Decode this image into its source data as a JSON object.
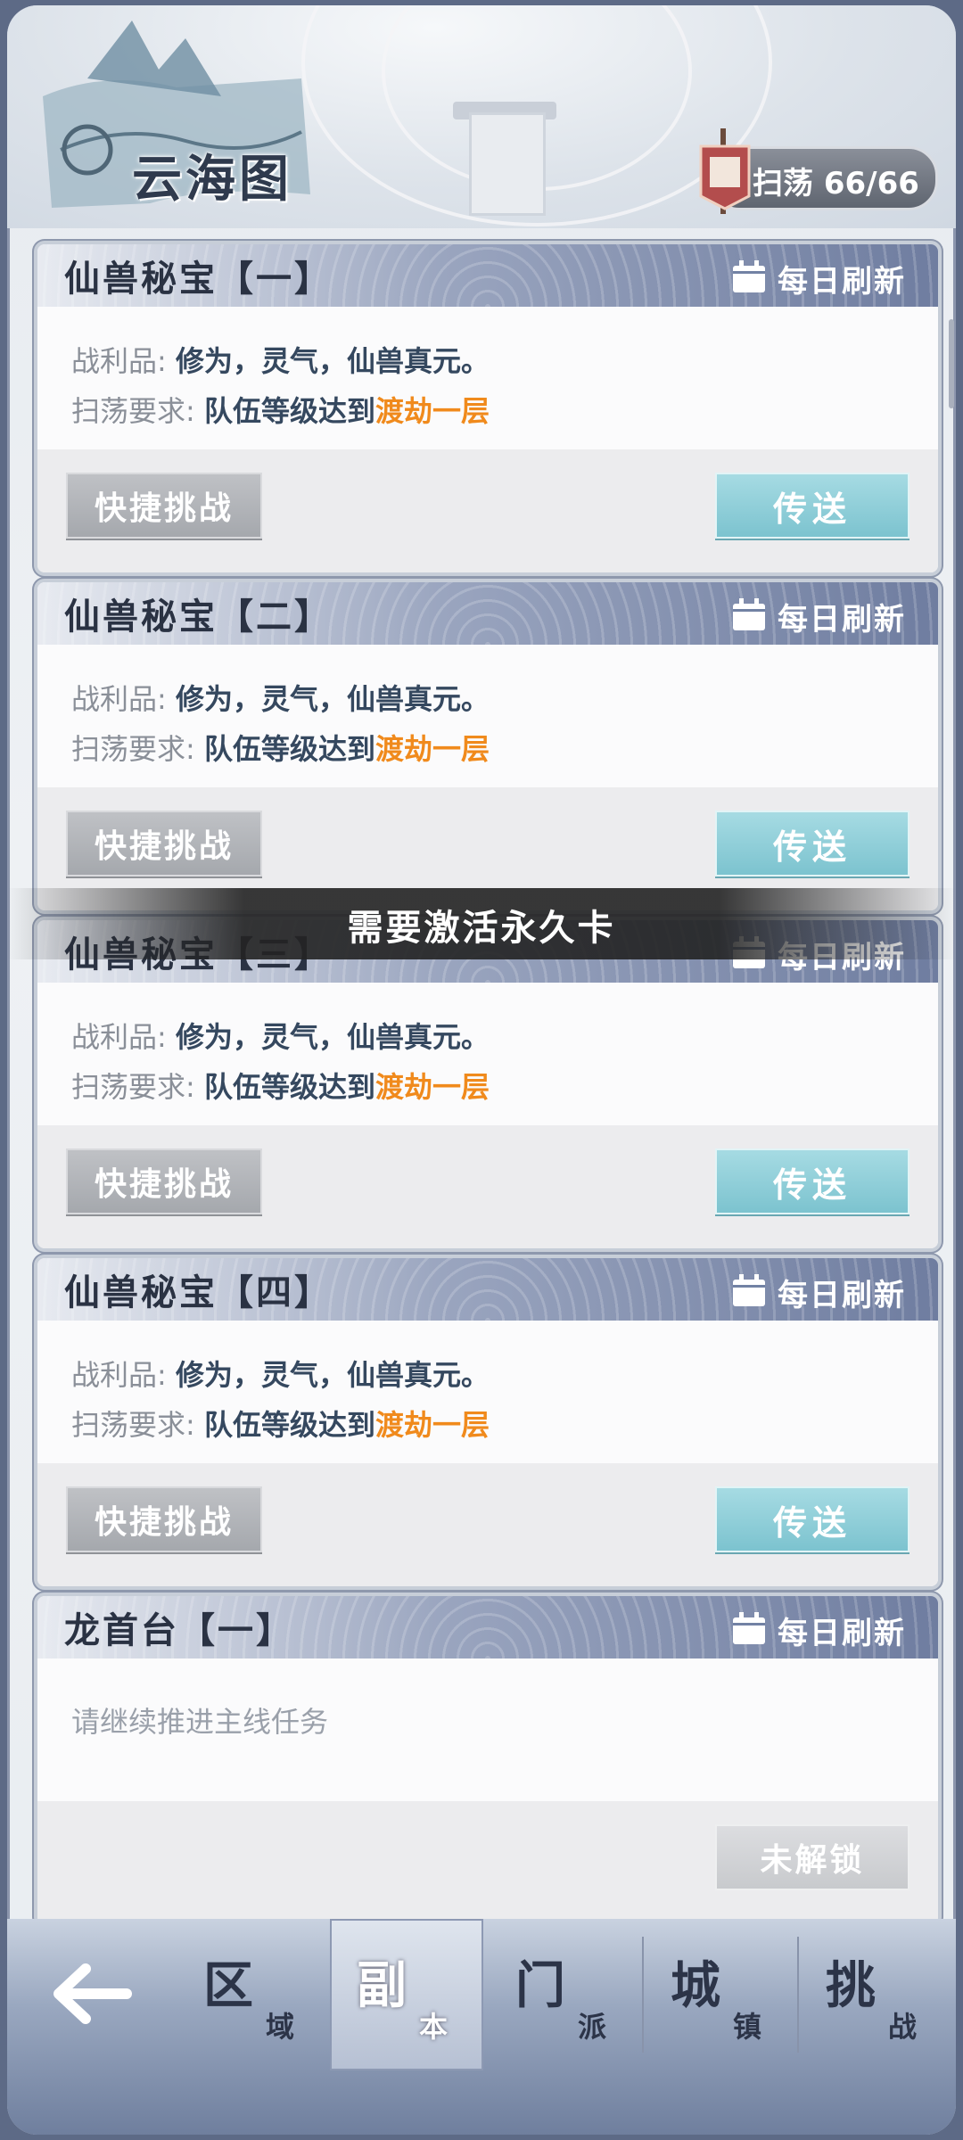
{
  "header": {
    "title": "云海图",
    "sweep_label": "扫荡 66/66",
    "flag_char": "扫荡"
  },
  "cards": [
    {
      "title": "仙兽秘宝【一】",
      "refresh": "每日刷新",
      "loot_label": "战利品:",
      "loot_value": "修为，灵气，仙兽真元。",
      "req_label": "扫荡要求:",
      "req_value": "队伍等级达到",
      "req_highlight": "渡劫一层",
      "quick_button": "快捷挑战",
      "teleport_button": "传送"
    },
    {
      "title": "仙兽秘宝【二】",
      "refresh": "每日刷新",
      "loot_label": "战利品:",
      "loot_value": "修为，灵气，仙兽真元。",
      "req_label": "扫荡要求:",
      "req_value": "队伍等级达到",
      "req_highlight": "渡劫一层",
      "quick_button": "快捷挑战",
      "teleport_button": "传送"
    },
    {
      "title": "仙兽秘宝【三】",
      "refresh": "每日刷新",
      "loot_label": "战利品:",
      "loot_value": "修为，灵气，仙兽真元。",
      "req_label": "扫荡要求:",
      "req_value": "队伍等级达到",
      "req_highlight": "渡劫一层",
      "quick_button": "快捷挑战",
      "teleport_button": "传送"
    },
    {
      "title": "仙兽秘宝【四】",
      "refresh": "每日刷新",
      "loot_label": "战利品:",
      "loot_value": "修为，灵气，仙兽真元。",
      "req_label": "扫荡要求:",
      "req_value": "队伍等级达到",
      "req_highlight": "渡劫一层",
      "quick_button": "快捷挑战",
      "teleport_button": "传送"
    },
    {
      "title": "龙首台【一】",
      "refresh": "每日刷新",
      "hint": "请继续推进主线任务",
      "locked_button": "未解锁"
    }
  ],
  "toast": "需要激活永久卡",
  "nav": [
    {
      "main": "区",
      "sub": "域"
    },
    {
      "main": "副",
      "sub": "本"
    },
    {
      "main": "门",
      "sub": "派"
    },
    {
      "main": "城",
      "sub": "镇"
    },
    {
      "main": "挑",
      "sub": "战"
    }
  ],
  "colors": {
    "highlight": "#f08a1c",
    "teleport": "#7cc3cf",
    "header_blue": "#6f7da0"
  }
}
